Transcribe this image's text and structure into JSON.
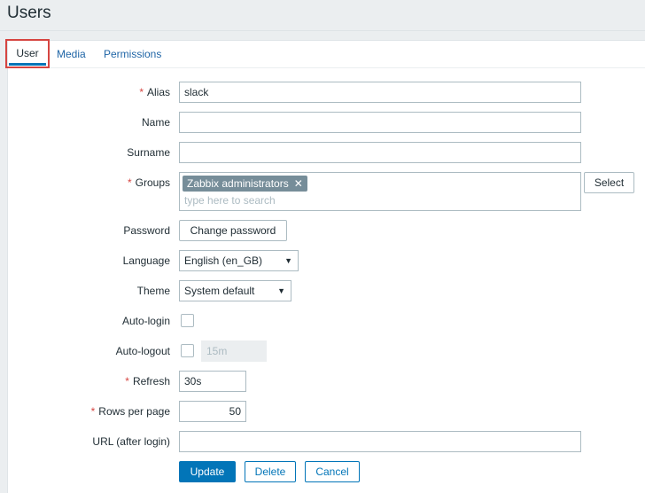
{
  "page": {
    "title": "Users"
  },
  "tabs": [
    {
      "label": "User",
      "active": true
    },
    {
      "label": "Media",
      "active": false
    },
    {
      "label": "Permissions",
      "active": false
    }
  ],
  "form": {
    "alias": {
      "label": "Alias",
      "required": true,
      "value": "slack"
    },
    "name": {
      "label": "Name",
      "value": ""
    },
    "surname": {
      "label": "Surname",
      "value": ""
    },
    "groups": {
      "label": "Groups",
      "required": true,
      "selected": [
        "Zabbix administrators"
      ],
      "placeholder": "type here to search",
      "select_label": "Select"
    },
    "password": {
      "label": "Password",
      "button_label": "Change password"
    },
    "language": {
      "label": "Language",
      "value": "English (en_GB)"
    },
    "theme": {
      "label": "Theme",
      "value": "System default"
    },
    "autologin": {
      "label": "Auto-login",
      "checked": false
    },
    "autologout": {
      "label": "Auto-logout",
      "checked": false,
      "value": "15m"
    },
    "refresh": {
      "label": "Refresh",
      "required": true,
      "value": "30s"
    },
    "rows_per_page": {
      "label": "Rows per page",
      "required": true,
      "value": "50"
    },
    "url": {
      "label": "URL (after login)",
      "value": ""
    }
  },
  "actions": {
    "update": "Update",
    "delete": "Delete",
    "cancel": "Cancel"
  },
  "icons": {
    "remove_chip": "close-icon",
    "dropdown": "chevron-down-icon"
  },
  "colors": {
    "primary": "#0275b8",
    "required": "#d64541",
    "chip": "#768d99"
  }
}
